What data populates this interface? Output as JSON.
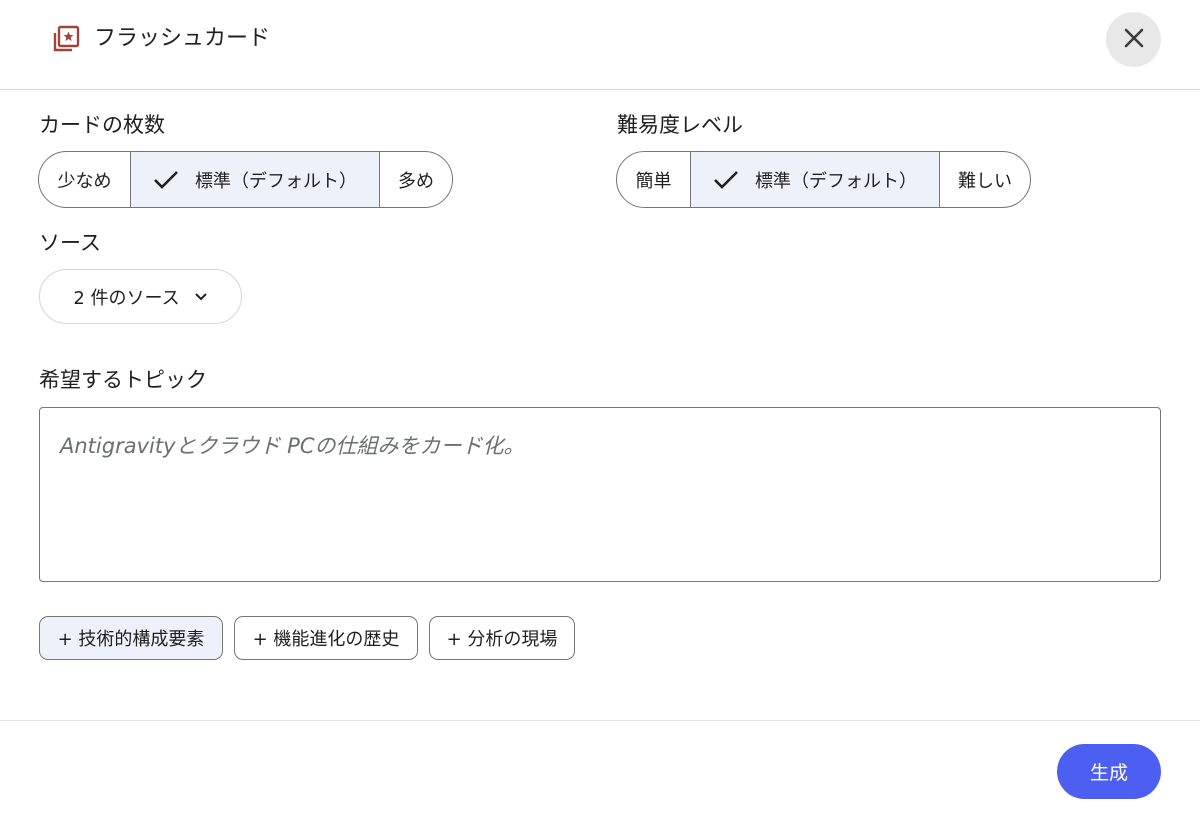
{
  "header": {
    "title": "フラッシュカード",
    "icon": "flashcard-star-icon",
    "close_icon": "close-icon"
  },
  "card_count": {
    "label": "カードの枚数",
    "options": [
      "少なめ",
      "標準（デフォルト）",
      "多め"
    ],
    "selected": "標準（デフォルト）"
  },
  "difficulty": {
    "label": "難易度レベル",
    "options": [
      "簡単",
      "標準（デフォルト）",
      "難しい"
    ],
    "selected": "標準（デフォルト）"
  },
  "source": {
    "label": "ソース",
    "dropdown_value": "2 件のソース"
  },
  "topic": {
    "label": "希望するトピック",
    "placeholder": "Antigravityとクラウド PCの仕組みをカード化。",
    "value": ""
  },
  "suggestions": [
    "+ 技術的構成要素",
    "+ 機能進化の歴史",
    "+ 分析の現場"
  ],
  "footer": {
    "generate_label": "生成"
  },
  "colors": {
    "accent": "#4c5ff0",
    "selected_bg": "#edf2fa",
    "icon_brand": "#a0433c"
  }
}
